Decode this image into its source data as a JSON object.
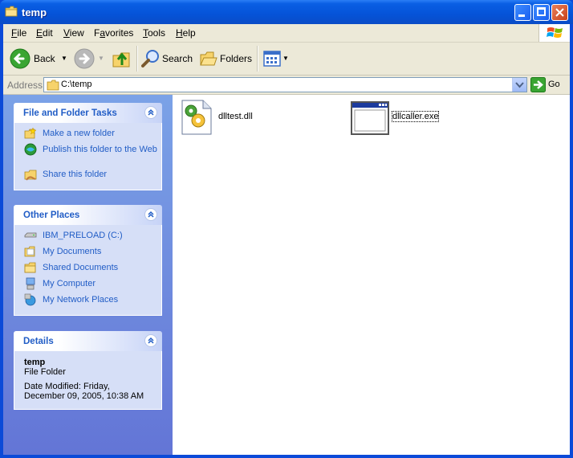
{
  "window": {
    "title": "temp"
  },
  "menu": {
    "items": [
      "File",
      "Edit",
      "View",
      "Favorites",
      "Tools",
      "Help"
    ],
    "underlines": [
      "F",
      "E",
      "V",
      "a",
      "T",
      "H"
    ]
  },
  "toolbar": {
    "back_label": "Back",
    "search_label": "Search",
    "folders_label": "Folders"
  },
  "address": {
    "label": "Address",
    "value": "C:\\temp",
    "go_label": "Go"
  },
  "tasks": {
    "file_folder": {
      "title": "File and Folder Tasks",
      "items": [
        {
          "label": "Make a new folder",
          "icon": "new-folder-icon"
        },
        {
          "label": "Publish this folder to the Web",
          "icon": "publish-web-icon"
        },
        {
          "label": "Share this folder",
          "icon": "share-folder-icon"
        }
      ]
    },
    "other_places": {
      "title": "Other Places",
      "items": [
        {
          "label": "IBM_PRELOAD (C:)",
          "icon": "drive-icon"
        },
        {
          "label": "My Documents",
          "icon": "my-documents-icon"
        },
        {
          "label": "Shared Documents",
          "icon": "folder-icon"
        },
        {
          "label": "My Computer",
          "icon": "my-computer-icon"
        },
        {
          "label": "My Network Places",
          "icon": "network-places-icon"
        }
      ]
    },
    "details": {
      "title": "Details",
      "name": "temp",
      "type": "File Folder",
      "modified": "Date Modified: Friday, December 09, 2005, 10:38 AM"
    }
  },
  "files": [
    {
      "name": "dlltest.dll",
      "icon": "dll-file-icon",
      "selected": false
    },
    {
      "name": "dllcaller.exe",
      "icon": "exe-file-icon",
      "selected": true
    }
  ],
  "colors": {
    "titlebar": "#0553d8",
    "task_link": "#215dc6",
    "panel_bg": "#d6dff7",
    "chrome": "#ece9d8"
  }
}
